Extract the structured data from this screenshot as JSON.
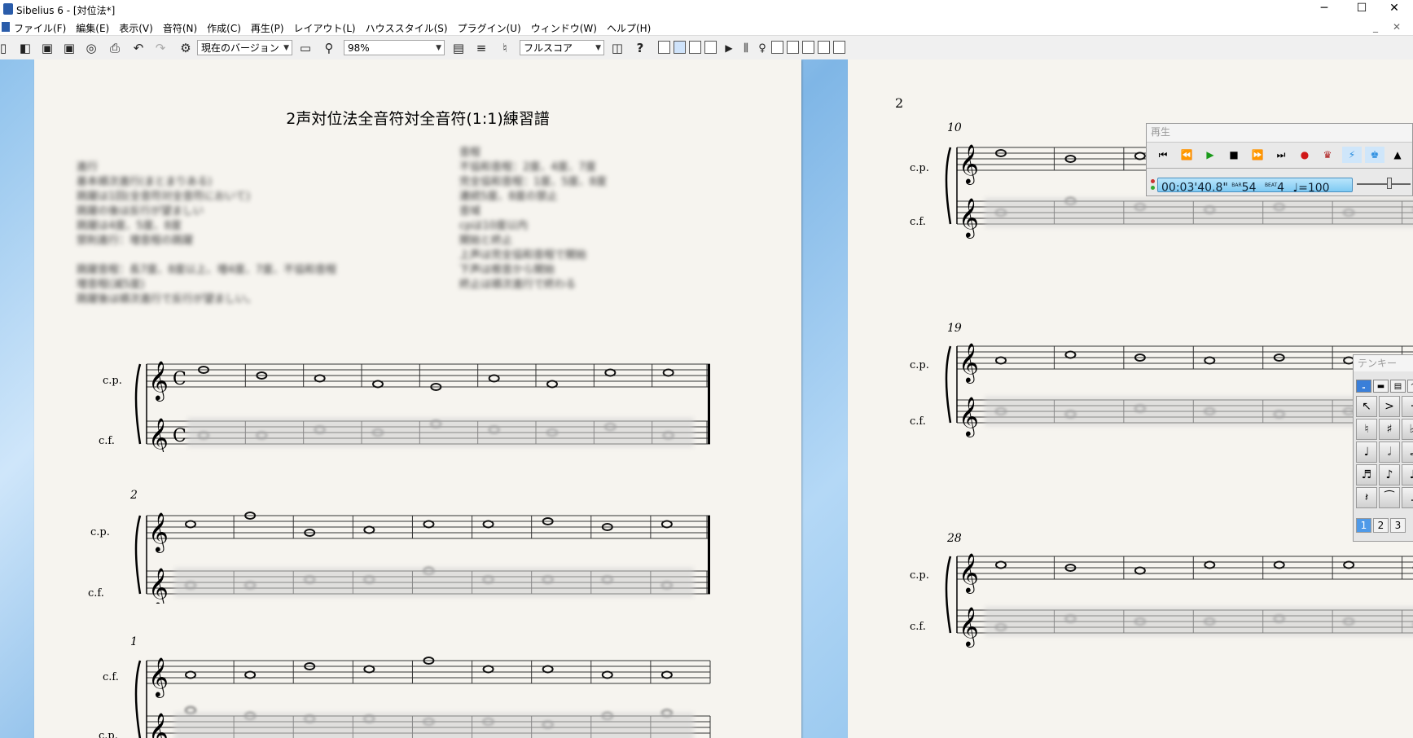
{
  "window": {
    "title": "Sibelius 6 - [対位法*]",
    "minimize": "─",
    "maximize": "☐",
    "close": "✕",
    "mdi_minimize": "_",
    "mdi_close": "✕"
  },
  "menu": [
    "ファイル(F)",
    "編集(E)",
    "表示(V)",
    "音符(N)",
    "作成(C)",
    "再生(P)",
    "レイアウト(L)",
    "ハウススタイル(S)",
    "プラグイン(U)",
    "ウィンドウ(W)",
    "ヘルプ(H)"
  ],
  "toolbar": {
    "version_select": "現在のバージョン",
    "zoom_select": "98%",
    "score_select": "フルスコア",
    "help_label": "?"
  },
  "score": {
    "title": "2声対位法全音符対全音符(1:1)練習譜",
    "page2_number": "2",
    "instruments": {
      "upper": "c.p.",
      "lower": "c.f."
    },
    "systems_page1": [
      {
        "number": "",
        "upper": "c.p.",
        "lower": "c.f."
      },
      {
        "number": "2",
        "upper": "c.p.",
        "lower": "c.f."
      },
      {
        "number": "1",
        "upper": "c.f.",
        "lower": "c.p."
      }
    ],
    "systems_page2": [
      {
        "number": "10",
        "upper": "c.p.",
        "lower": "c.f."
      },
      {
        "number": "19",
        "upper": "c.p.",
        "lower": "c.f."
      },
      {
        "number": "28",
        "upper": "c.p.",
        "lower": "c.f."
      }
    ],
    "notes_text": {
      "left": [
        "進行",
        "基本順次進行(まとまりある)",
        "跳躍は1回(全音符対全音符において)",
        "跳躍の後は反行が望ましい",
        "跳躍は4度、5度、8度",
        "禁則進行：増音程の跳躍",
        "",
        "跳躍音程：長7度、8度以上、増4度、7度、不協和音程",
        "増音程(減5度)",
        "跳躍後は順次進行で反行が望ましい。"
      ],
      "right": [
        "音程",
        "不協和音程：2度、4度、7度",
        "完全協和音程：1度、5度、8度",
        "連続5度、8度の禁止",
        "音域",
        "cpは10度以内",
        "開始と終止",
        "上声は完全協和音程で開始",
        "下声は根音から開始",
        "終止は順次進行で終わる"
      ]
    }
  },
  "playback": {
    "title": "再生",
    "time": "00:03'40.8\"",
    "bar_label": "BAR",
    "bar": "54",
    "beat_label": "BEAT",
    "beat": "4",
    "tempo": "♩=100"
  },
  "keypad": {
    "title": "テンキー",
    "layers": [
      "1",
      "2",
      "3"
    ]
  }
}
